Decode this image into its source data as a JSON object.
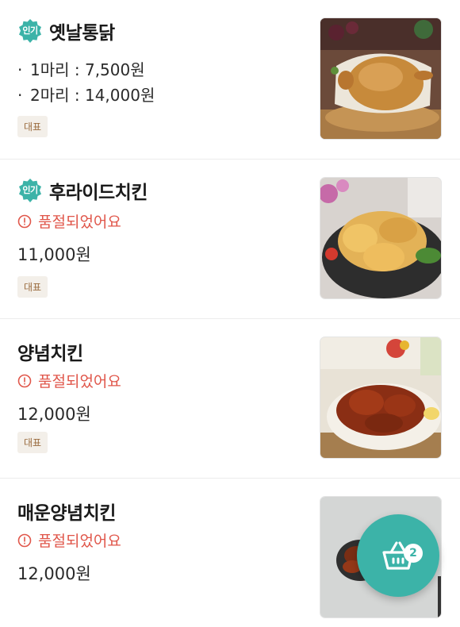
{
  "badges": {
    "popular": "인기",
    "representative": "대표"
  },
  "colors": {
    "accent": "#3cb3a8",
    "soldout": "#e0564a",
    "badge_text": "#9a6b3e",
    "badge_bg": "#f3efe9"
  },
  "items": [
    {
      "name": "옛날통닭",
      "popular": true,
      "options": [
        "1마리 : 7,500원",
        "2마리 : 14,000원"
      ],
      "representative": true,
      "image": "whole-fried-chicken-photo"
    },
    {
      "name": "후라이드치킨",
      "popular": true,
      "status": "품절되었어요",
      "price": "11,000원",
      "representative": true,
      "image": "fried-chicken-photo"
    },
    {
      "name": "양념치킨",
      "popular": false,
      "status": "품절되었어요",
      "price": "12,000원",
      "representative": true,
      "image": "seasoned-chicken-photo"
    },
    {
      "name": "매운양념치킨",
      "popular": false,
      "status": "품절되었어요",
      "price": "12,000원",
      "representative": false,
      "image": "spicy-seasoned-chicken-photo"
    }
  ],
  "cart": {
    "count": "2",
    "icon": "shopping-basket-icon"
  }
}
